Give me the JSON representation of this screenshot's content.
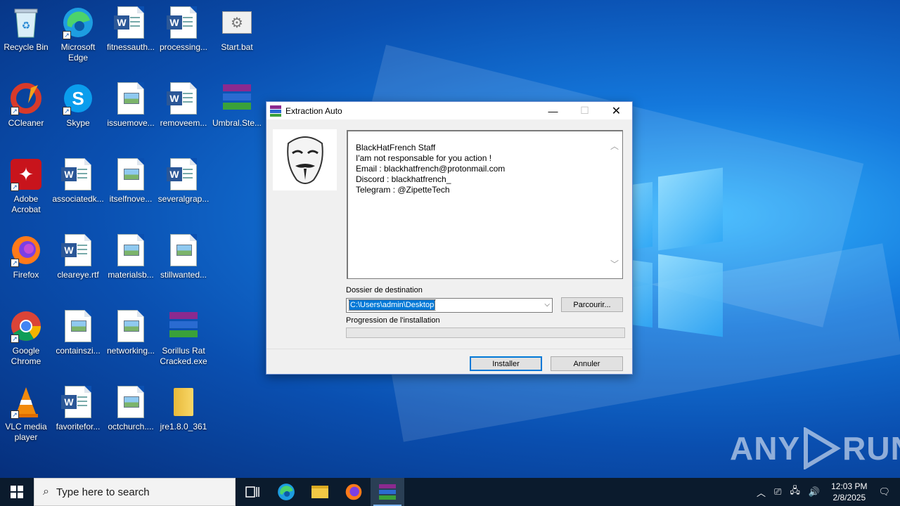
{
  "desktop": {
    "icons": [
      {
        "label": "Recycle Bin"
      },
      {
        "label": "Microsoft Edge"
      },
      {
        "label": "fitnessauth..."
      },
      {
        "label": "processing..."
      },
      {
        "label": "Start.bat"
      },
      {
        "label": "CCleaner"
      },
      {
        "label": "Skype"
      },
      {
        "label": "issuemove..."
      },
      {
        "label": "removeem..."
      },
      {
        "label": "Umbral.Ste..."
      },
      {
        "label": "Adobe Acrobat"
      },
      {
        "label": "associatedk..."
      },
      {
        "label": "itselfnove..."
      },
      {
        "label": "severalgrap..."
      },
      {
        "label": "Firefox"
      },
      {
        "label": "cleareye.rtf"
      },
      {
        "label": "materialsb..."
      },
      {
        "label": "stillwanted..."
      },
      {
        "label": "Google Chrome"
      },
      {
        "label": "containszi..."
      },
      {
        "label": "networking..."
      },
      {
        "label": "Sorillus Rat Cracked.exe"
      },
      {
        "label": "VLC media player"
      },
      {
        "label": "favoritefor..."
      },
      {
        "label": "octchurch...."
      },
      {
        "label": "jre1.8.0_361"
      }
    ]
  },
  "dialog": {
    "title": "Extraction Auto",
    "message_lines": [
      "BlackHatFrench Staff",
      "I'am not responsable for you action !",
      "Email : blackhatfrench@protonmail.com",
      "Discord : blackhatfrench_",
      "Telegram : @ZipetteTech"
    ],
    "dest_label": "Dossier de destination",
    "dest_value": "C:\\Users\\admin\\Desktop",
    "browse_label": "Parcourir...",
    "progress_label": "Progression de l'installation",
    "progress": 0,
    "install_label": "Installer",
    "cancel_label": "Annuler"
  },
  "watermark": {
    "left": "ANY",
    "right": "RUN"
  },
  "taskbar": {
    "search_placeholder": "Type here to search",
    "time": "12:03 PM",
    "date": "2/8/2025"
  }
}
